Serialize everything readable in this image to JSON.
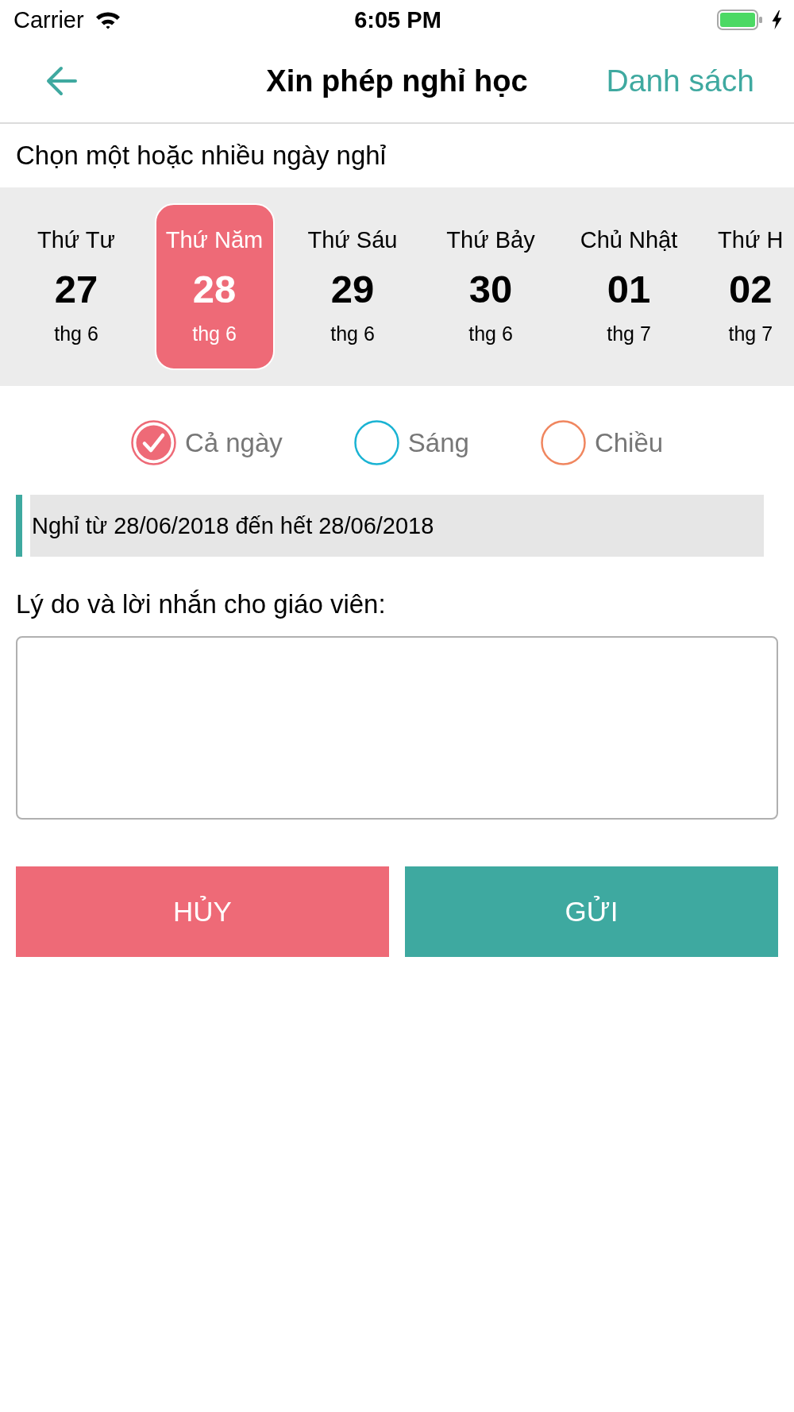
{
  "status_bar": {
    "carrier": "Carrier",
    "time": "6:05 PM"
  },
  "header": {
    "title": "Xin phép nghỉ học",
    "action": "Danh sách"
  },
  "day_picker": {
    "prompt": "Chọn một hoặc nhiều ngày nghỉ",
    "days": [
      {
        "weekday": "Thứ Tư",
        "day": "27",
        "month": "thg 6",
        "selected": false
      },
      {
        "weekday": "Thứ Năm",
        "day": "28",
        "month": "thg 6",
        "selected": true
      },
      {
        "weekday": "Thứ Sáu",
        "day": "29",
        "month": "thg 6",
        "selected": false
      },
      {
        "weekday": "Thứ Bảy",
        "day": "30",
        "month": "thg 6",
        "selected": false
      },
      {
        "weekday": "Chủ Nhật",
        "day": "01",
        "month": "thg 7",
        "selected": false
      },
      {
        "weekday": "Thứ H",
        "day": "02",
        "month": "thg 7",
        "selected": false
      }
    ]
  },
  "sessions": [
    {
      "label": "Cả ngày",
      "color": "#ee6a77",
      "selected": true
    },
    {
      "label": "Sáng",
      "color": "#1ab3d3",
      "selected": false
    },
    {
      "label": "Chiều",
      "color": "#f0865f",
      "selected": false
    }
  ],
  "summary": "Nghỉ từ 28/06/2018 đến hết 28/06/2018",
  "reason": {
    "label": "Lý do và lời nhắn cho giáo viên:"
  },
  "buttons": [
    {
      "label": "HỦY",
      "kind": "cancel"
    },
    {
      "label": "GỬI",
      "kind": "submit"
    }
  ]
}
